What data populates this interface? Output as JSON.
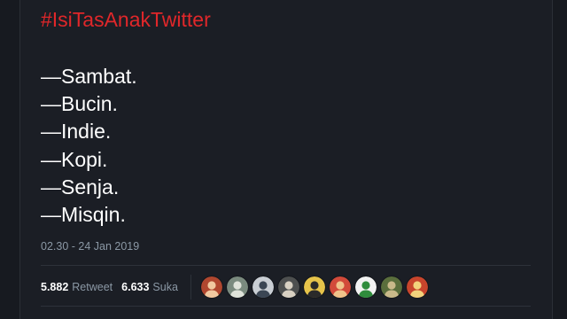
{
  "tweet": {
    "hashtag": "#IsiTasAnakTwitter",
    "lines": [
      "—Sambat.",
      "—Bucin.",
      "—Indie.",
      "—Kopi.",
      "—Senja.",
      "—Misqin."
    ],
    "timestamp": "02.30 - 24 Jan 2019"
  },
  "stats": {
    "retweets_count": "5.882",
    "retweets_label": "Retweet",
    "likes_count": "6.633",
    "likes_label": "Suka"
  },
  "likers": [
    {
      "icon": "user-avatar-icon",
      "bg": "#b0472f",
      "fg": "#f1c9a0"
    },
    {
      "icon": "user-avatar-icon",
      "bg": "#7a8a7e",
      "fg": "#dfe3da"
    },
    {
      "icon": "user-avatar-icon",
      "bg": "#c9ced4",
      "fg": "#3b4654"
    },
    {
      "icon": "user-avatar-icon",
      "bg": "#4d4f4f",
      "fg": "#d8d0c2"
    },
    {
      "icon": "user-avatar-icon",
      "bg": "#e6c34a",
      "fg": "#2a2a2a"
    },
    {
      "icon": "user-avatar-icon",
      "bg": "#d24a3a",
      "fg": "#f0c38a"
    },
    {
      "icon": "user-avatar-icon",
      "bg": "#f2f2f2",
      "fg": "#2f8c3c"
    },
    {
      "icon": "user-avatar-icon",
      "bg": "#5a6e3c",
      "fg": "#c9b98a"
    },
    {
      "icon": "user-avatar-icon",
      "bg": "#c8452c",
      "fg": "#f3d37c"
    }
  ],
  "colors": {
    "background": "#1b1e25",
    "hashtag": "#e0272a",
    "text": "#ffffff",
    "muted": "#8b98a5",
    "divider": "#2d323a"
  }
}
